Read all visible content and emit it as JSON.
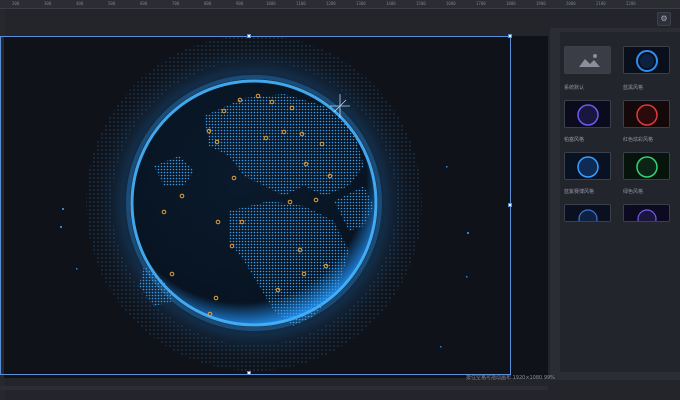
{
  "ruler": {
    "ticks": [
      "200",
      "300",
      "400",
      "500",
      "600",
      "700",
      "800",
      "900",
      "1000",
      "1100",
      "1200",
      "1300",
      "1400",
      "1500",
      "1600",
      "1700",
      "1800",
      "1900",
      "2000",
      "2100",
      "2200"
    ]
  },
  "toolbar": {
    "corner_icon": "settings-icon"
  },
  "panel": {
    "themes": [
      {
        "label": "系统默认",
        "style": "default"
      },
      {
        "label": "蓝黑风格",
        "style": "blue-dark"
      },
      {
        "label": "帕塞风格",
        "style": "purple"
      },
      {
        "label": "红色炫彩风格",
        "style": "red"
      },
      {
        "label": "蓝紫赛博风格",
        "style": "blue-cyber"
      },
      {
        "label": "绿色风格",
        "style": "green"
      },
      {
        "label": "",
        "style": "blue-small"
      },
      {
        "label": "",
        "style": "purple-small"
      }
    ]
  },
  "status": {
    "text": "按住空格可拖动画布 1920×1080 99%"
  },
  "colors": {
    "accent": "#5b8ed8",
    "globe": "#2f9ff0",
    "city": "#e8a23a"
  }
}
